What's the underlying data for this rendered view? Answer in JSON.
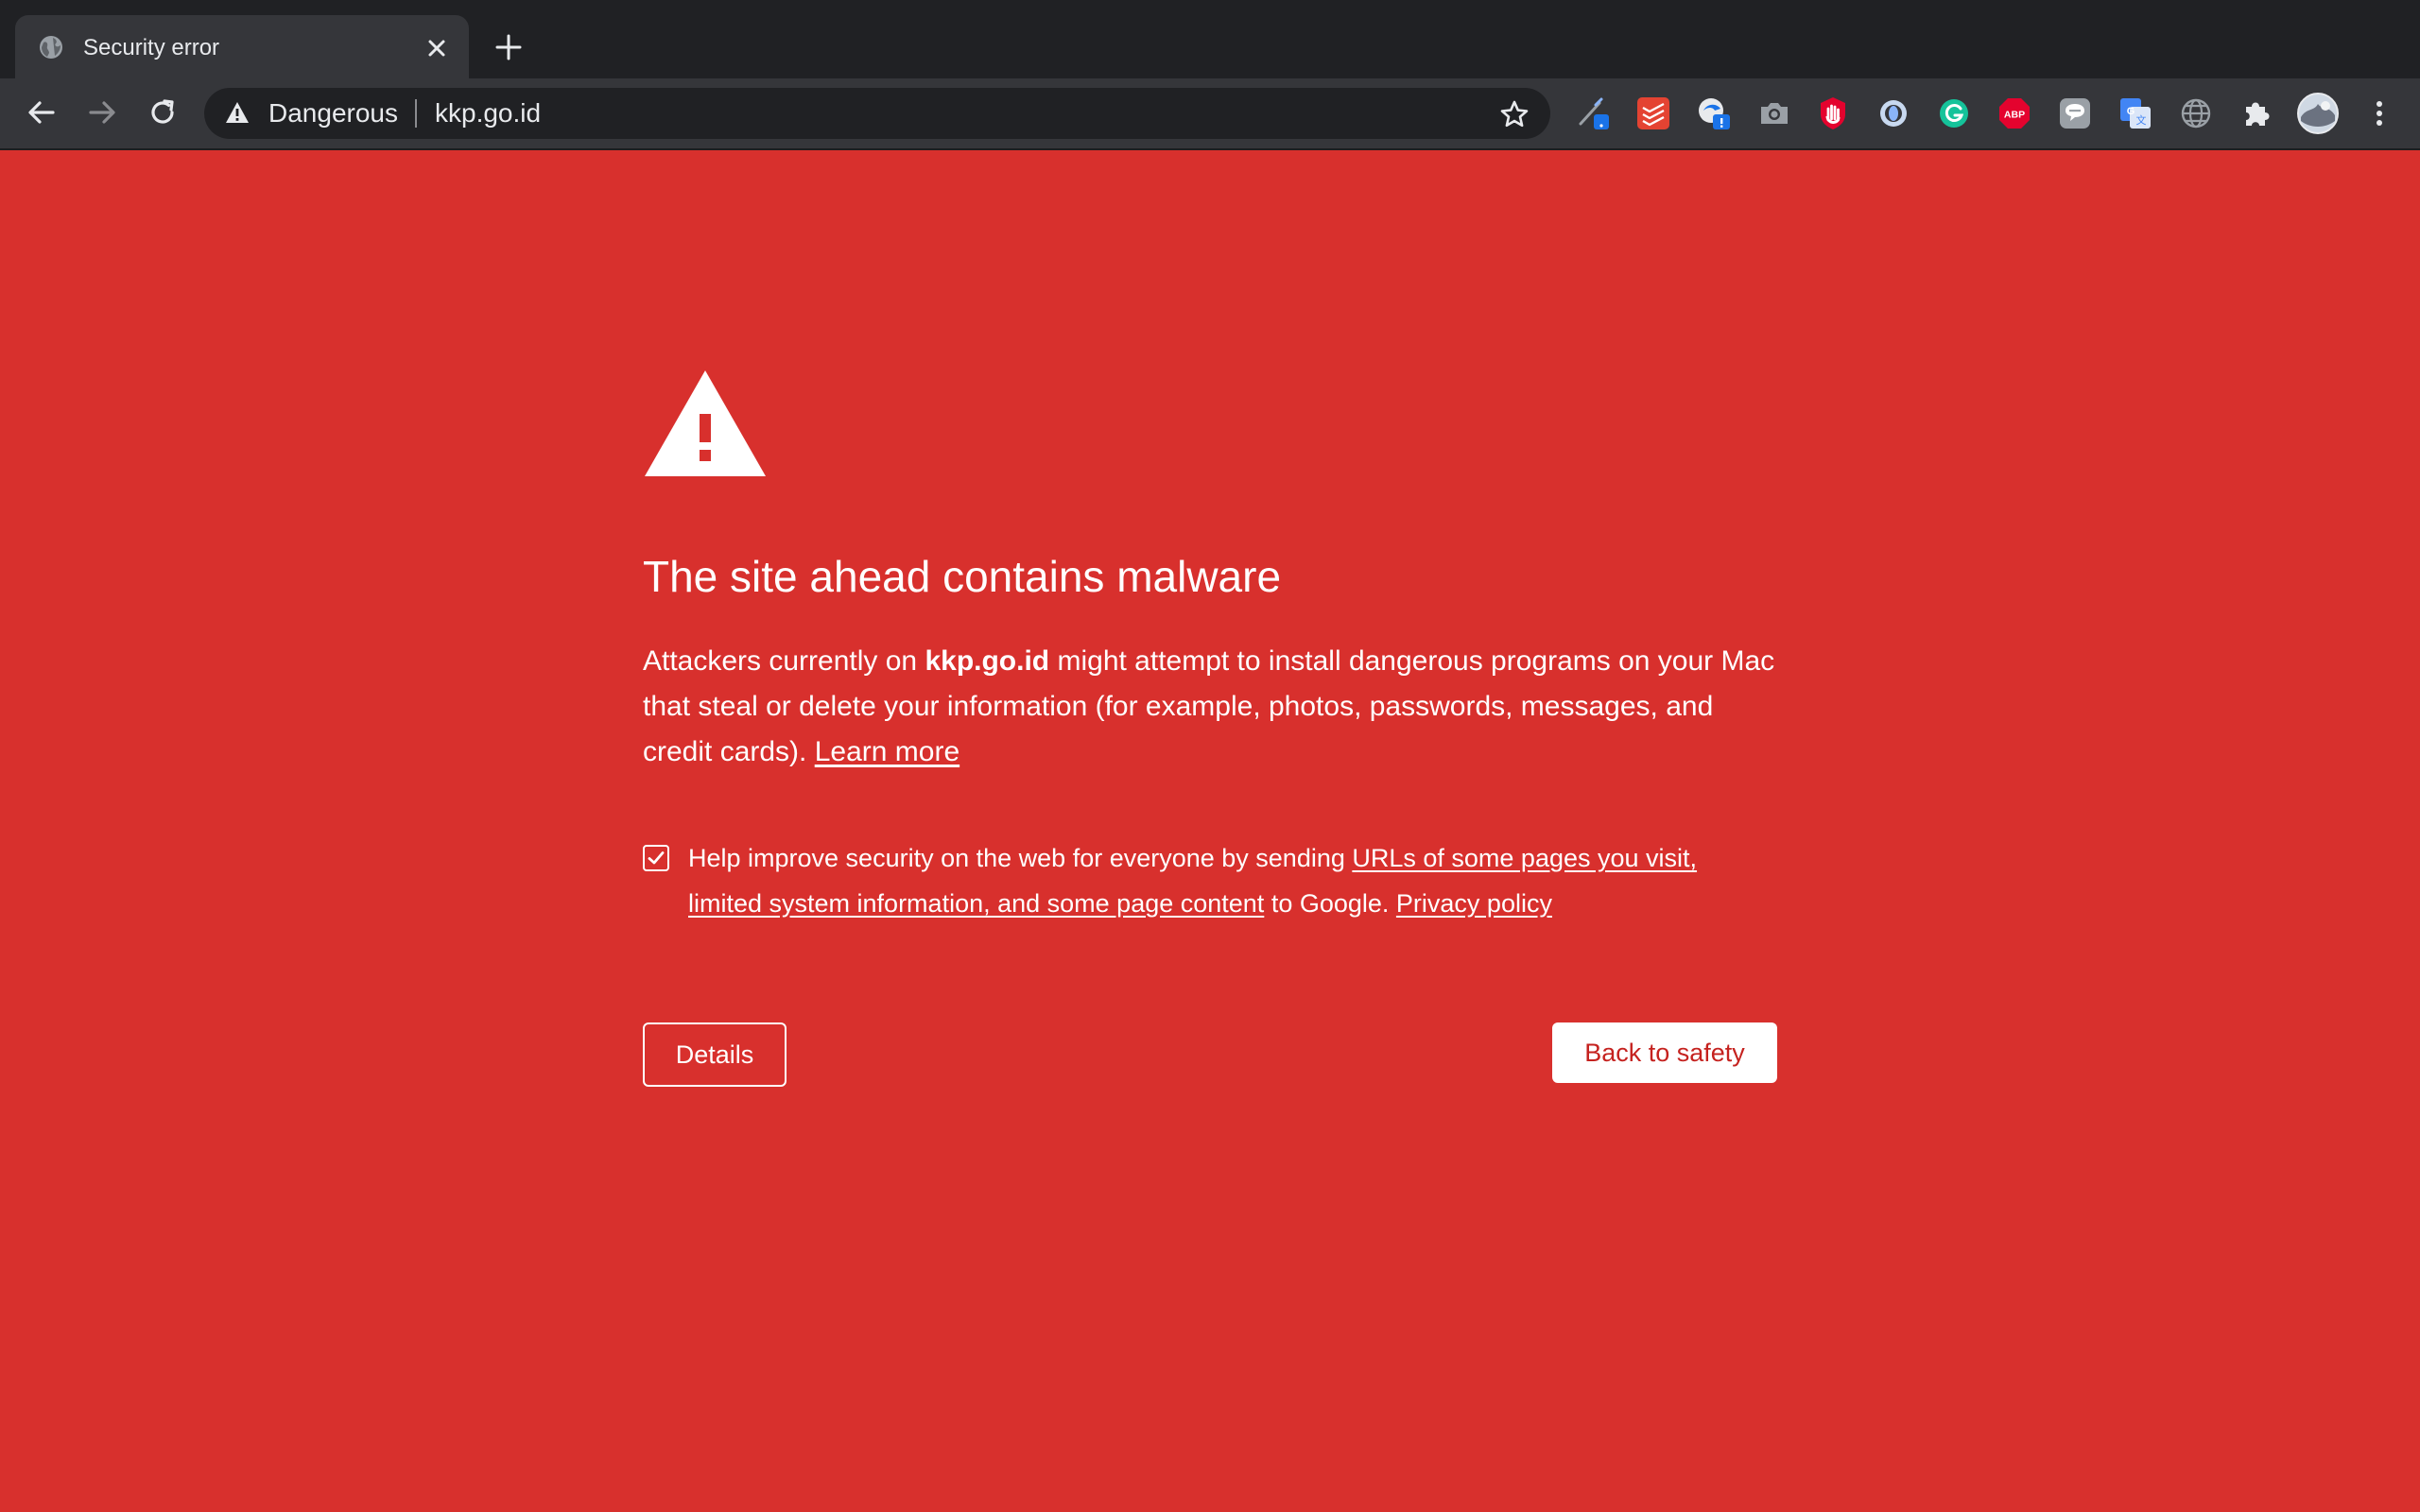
{
  "tab": {
    "title": "Security error",
    "favicon": "globe-icon"
  },
  "omnibox": {
    "security_label": "Dangerous",
    "url": "kkp.go.id"
  },
  "extensions": [
    "pen-tool-icon",
    "todoist-icon",
    "bird-icon",
    "camera-icon",
    "hand-stop-icon",
    "circle-ring-icon",
    "grammarly-icon",
    "adblock-plus-icon",
    "chat-bubble-icon",
    "google-translate-icon",
    "globe-icon",
    "puzzle-icon",
    "profile-avatar",
    "more-menu-icon"
  ],
  "interstitial": {
    "heading": "The site ahead contains malware",
    "p1_before": "Attackers currently on ",
    "p1_host": "kkp.go.id",
    "p1_after": " might attempt to install dangerous programs on your Mac that steal or delete your information (for example, photos, passwords, messages, and credit cards). ",
    "learn_more": "Learn more",
    "opt_in_before": "Help improve security on the web for everyone by sending ",
    "opt_in_link": "URLs of some pages you visit, limited system information, and some page content",
    "opt_in_after": " to Google. ",
    "privacy_policy": "Privacy policy",
    "opt_in_checked": true,
    "details_button": "Details",
    "back_button": "Back to safety"
  },
  "colors": {
    "background": "#d8302d",
    "button_text": "#c5221f",
    "toolbar": "#35363a",
    "tabstrip": "#202124"
  }
}
